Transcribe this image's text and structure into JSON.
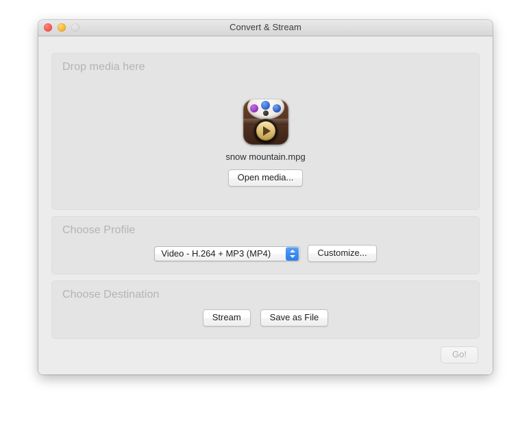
{
  "window": {
    "title": "Convert & Stream",
    "traffic_lights": [
      {
        "name": "close",
        "label": "Close",
        "color": "#f9564e"
      },
      {
        "name": "minimize",
        "label": "Minimize",
        "color": "#f9b62c"
      },
      {
        "name": "zoom",
        "label": "Zoom",
        "color": "#dcdcdc"
      }
    ]
  },
  "drop_section": {
    "title": "Drop media here",
    "media_icon_name": "media-file-icon",
    "media_filename": "snow mountain.mpg",
    "open_media_label": "Open media..."
  },
  "profile_section": {
    "title": "Choose Profile",
    "selected_profile": "Video - H.264 + MP3 (MP4)",
    "dropdown_icon": "chevron-up-down-icon",
    "dropdown_accent_color": "#3d8bf0",
    "customize_label": "Customize..."
  },
  "destination_section": {
    "title": "Choose Destination",
    "stream_label": "Stream",
    "save_as_file_label": "Save as File"
  },
  "footer": {
    "go_label": "Go!",
    "go_enabled": false
  }
}
